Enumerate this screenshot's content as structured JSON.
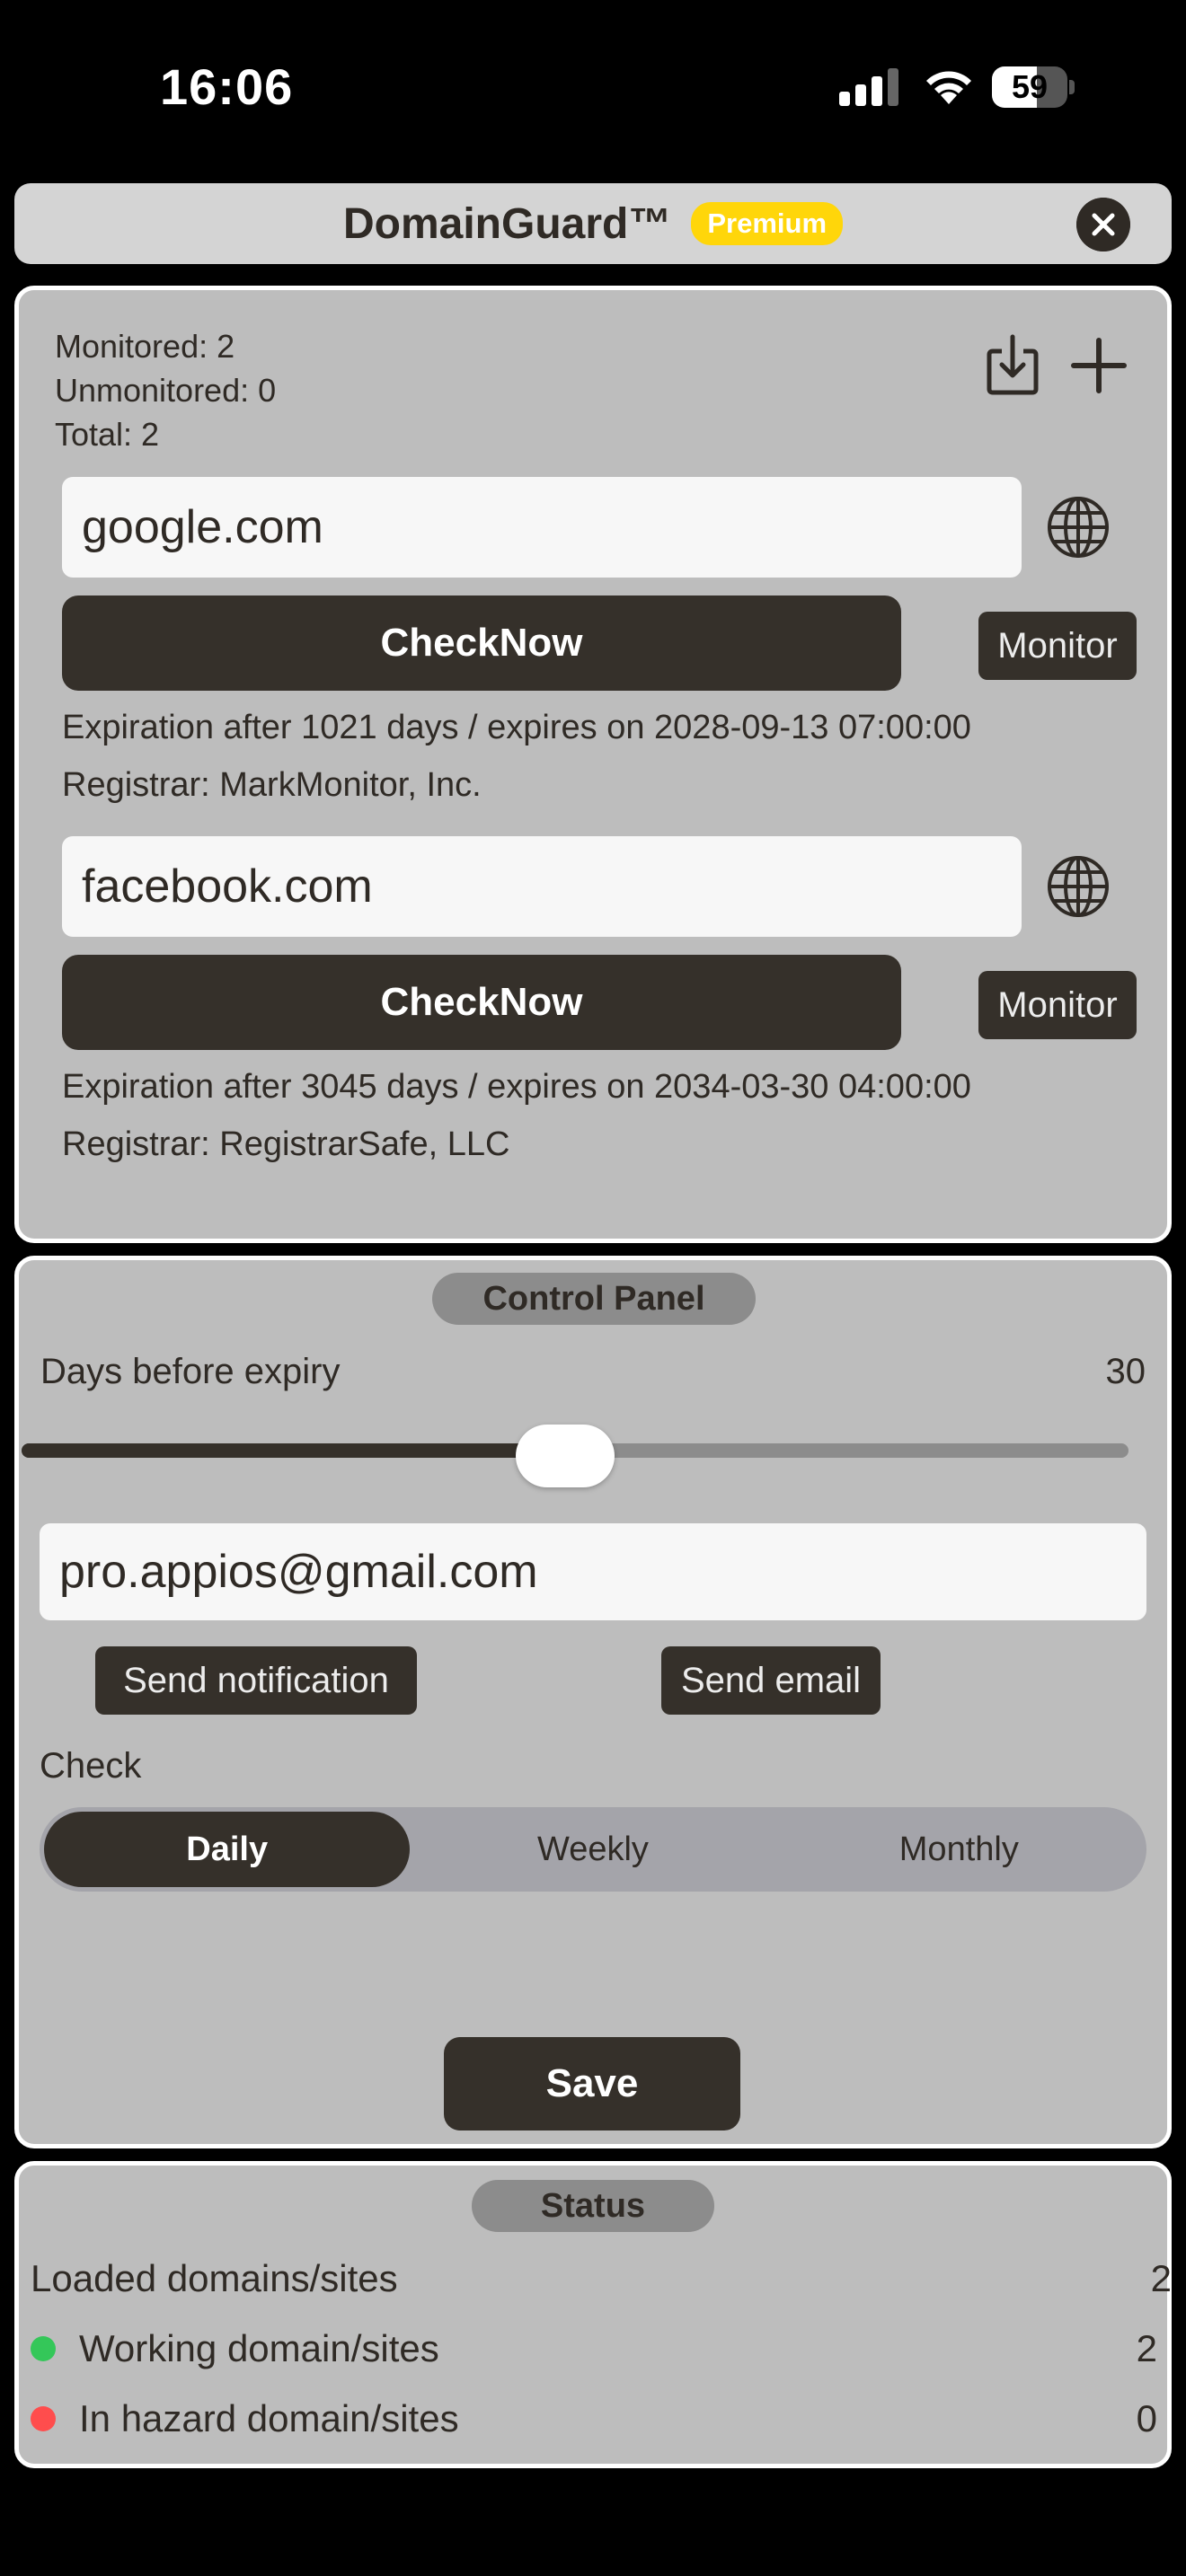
{
  "status_bar": {
    "time": "16:06",
    "battery": "59",
    "battery_level": 0.59
  },
  "header": {
    "title": "DomainGuard™",
    "badge": "Premium"
  },
  "summary": {
    "monitored": "Monitored: 2",
    "unmonitored": "Unmonitored: 0",
    "total": "Total: 2"
  },
  "domains": [
    {
      "name": "google.com",
      "check_label": "CheckNow",
      "monitor_label": "Monitor",
      "expiration": "Expiration after 1021 days / expires on 2028-09-13 07:00:00",
      "registrar": "Registrar: MarkMonitor, Inc."
    },
    {
      "name": "facebook.com",
      "check_label": "CheckNow",
      "monitor_label": "Monitor",
      "expiration": "Expiration after 3045 days / expires on 2034-03-30 04:00:00",
      "registrar": "Registrar: RegistrarSafe, LLC"
    }
  ],
  "control_panel": {
    "title": "Control Panel",
    "days_label": "Days before expiry",
    "days_value": "30",
    "slider_fraction": 0.5,
    "email": "pro.appios@gmail.com",
    "send_notification": "Send notification",
    "send_email": "Send email",
    "check_label": "Check",
    "check_options": [
      "Daily",
      "Weekly",
      "Monthly"
    ],
    "check_selected": "Daily",
    "save_label": "Save"
  },
  "status": {
    "title": "Status",
    "loaded_label": "Loaded domains/sites",
    "loaded_value": "2",
    "working_label": "Working domain/sites",
    "working_value": "2",
    "hazard_label": "In hazard domain/sites",
    "hazard_value": "0"
  },
  "colors": {
    "accent_dark": "#35302a",
    "premium": "#ffd60a",
    "working_dot": "#34c759",
    "hazard_dot": "#ff4d4d"
  }
}
